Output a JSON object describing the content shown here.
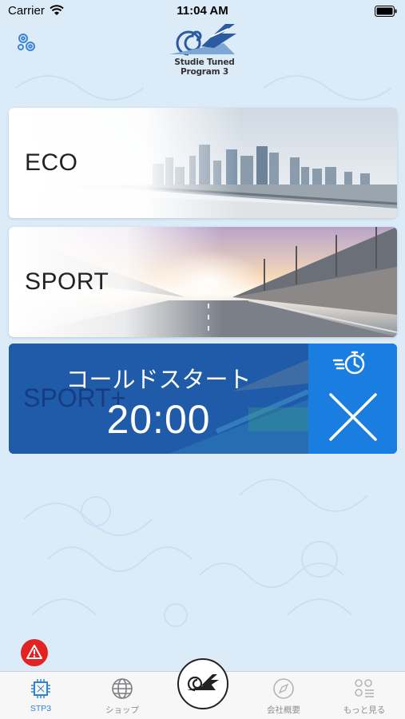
{
  "status_bar": {
    "carrier": "Carrier",
    "time": "11:04 AM"
  },
  "header": {
    "logo_text": "Studie Tuned Program 3"
  },
  "modes": [
    {
      "label": "ECO"
    },
    {
      "label": "SPORT"
    }
  ],
  "sport_plus": {
    "background_label": "SPORT+",
    "cold_start_title": "コールドスタート",
    "timer": "20:00"
  },
  "tabs": [
    {
      "label": "STP3",
      "icon": "chip-icon",
      "active": true
    },
    {
      "label": "ショップ",
      "icon": "globe-icon",
      "active": false
    },
    {
      "label": "",
      "icon": "logo-icon",
      "active": false
    },
    {
      "label": "会社概要",
      "icon": "compass-icon",
      "active": false
    },
    {
      "label": "もっと見る",
      "icon": "more-icon",
      "active": false
    }
  ],
  "colors": {
    "background": "#dcebf8",
    "accent_blue": "#1a7de0",
    "sport_plus_blue": "#1d5aa6",
    "tab_active": "#2d83d6",
    "warning_red": "#e32222"
  }
}
